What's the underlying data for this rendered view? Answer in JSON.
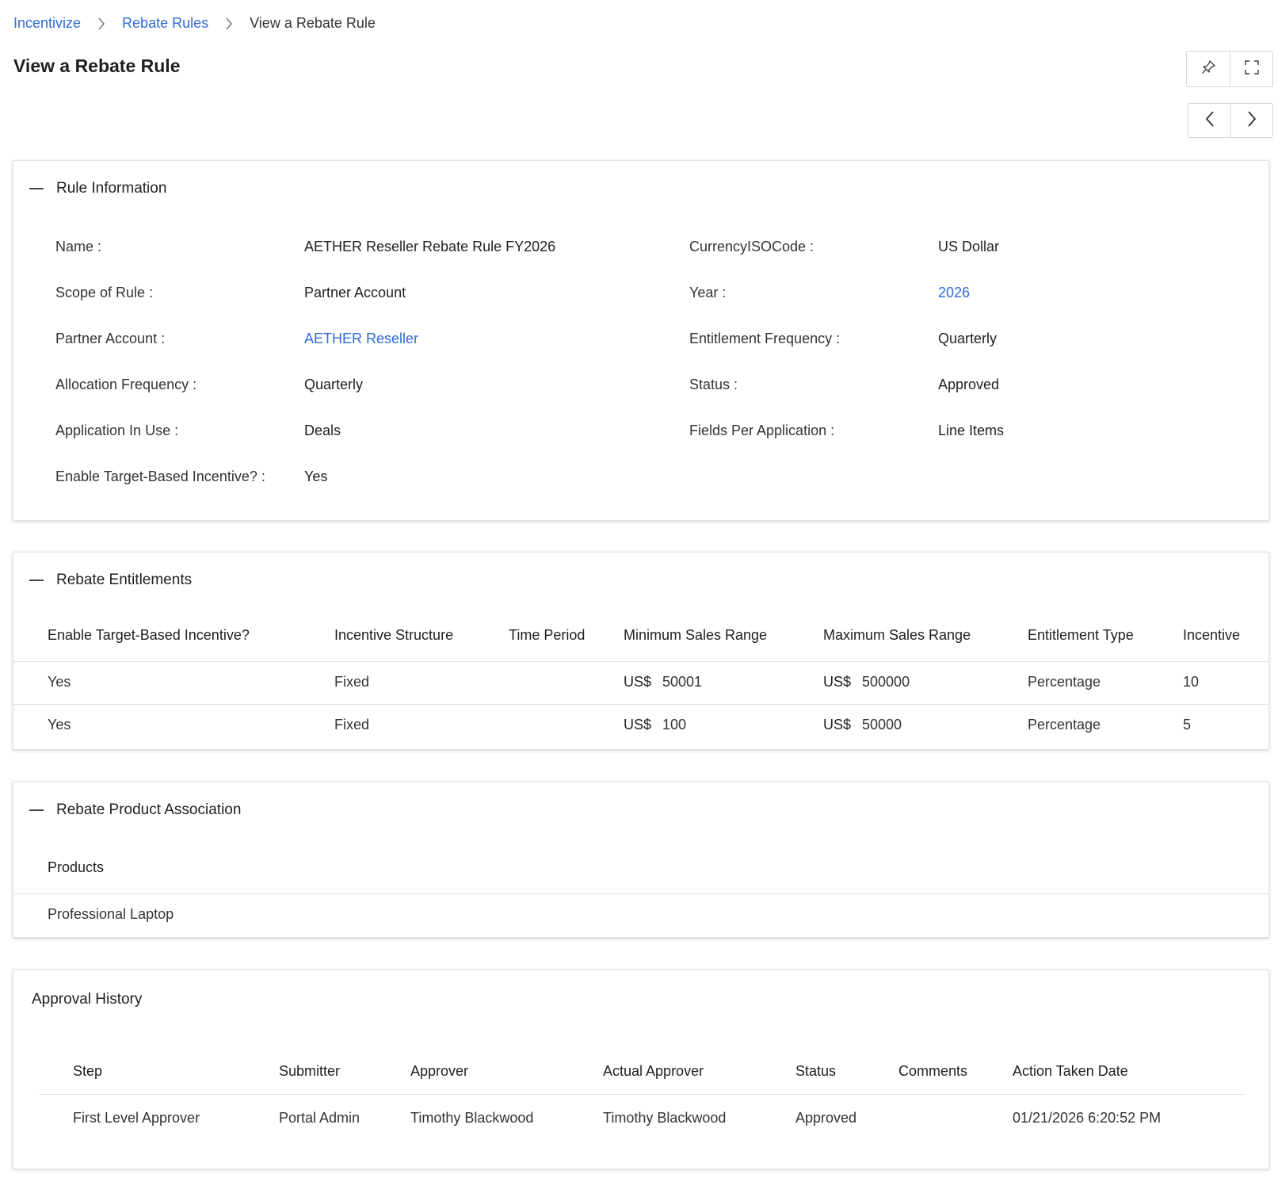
{
  "breadcrumb": [
    {
      "label": "Incentivize"
    },
    {
      "label": "Rebate Rules"
    },
    {
      "label": "View a Rebate Rule"
    }
  ],
  "page_title": "View a Rebate Rule",
  "toolbar": {
    "pin_icon": "pin-icon",
    "fullscreen_icon": "expand-icon",
    "prev_icon": "chevron-left-icon",
    "next_icon": "chevron-right-icon"
  },
  "rule_info": {
    "title": "Rule Information",
    "fields": [
      {
        "label": "Name :",
        "value": "AETHER Reseller Rebate Rule FY2026"
      },
      {
        "label": "CurrencyISOCode :",
        "value": "US Dollar"
      },
      {
        "label": "Scope of Rule :",
        "value": "Partner Account"
      },
      {
        "label": "Year :",
        "value": "2026"
      },
      {
        "label": "Partner Account :",
        "value": "AETHER Reseller"
      },
      {
        "label": "Entitlement Frequency :",
        "value": "Quarterly"
      },
      {
        "label": "Allocation Frequency :",
        "value": "Quarterly"
      },
      {
        "label": "Status :",
        "value": "Approved"
      },
      {
        "label": "Application In Use :",
        "value": "Deals"
      },
      {
        "label": "Fields Per Application :",
        "value": "Line Items"
      },
      {
        "label": "Enable Target-Based Incentive? :",
        "value": "Yes"
      }
    ]
  },
  "entitlements": {
    "title": "Rebate Entitlements",
    "headers": [
      "Enable Target-Based Incentive?",
      "Incentive Structure",
      "Time Period",
      "Minimum Sales Range",
      "Maximum Sales Range",
      "Entitlement Type",
      "Incentive"
    ],
    "rows": [
      {
        "target": "Yes",
        "structure": "Fixed",
        "period": "",
        "min_cur": "US$",
        "min": "50001",
        "max_cur": "US$",
        "max": "500000",
        "type": "Percentage",
        "incentive": "10"
      },
      {
        "target": "Yes",
        "structure": "Fixed",
        "period": "",
        "min_cur": "US$",
        "min": "100",
        "max_cur": "US$",
        "max": "50000",
        "type": "Percentage",
        "incentive": "5"
      }
    ]
  },
  "products": {
    "title": "Rebate Product Association",
    "header": "Products",
    "items": [
      "Professional Laptop"
    ]
  },
  "approval": {
    "title": "Approval History",
    "headers": [
      "Step",
      "Submitter",
      "Approver",
      "Actual Approver",
      "Status",
      "Comments",
      "Action Taken Date"
    ],
    "rows": [
      {
        "step": "First Level Approver",
        "submitter": "Portal Admin",
        "approver": "Timothy Blackwood",
        "actual": "Timothy Blackwood",
        "status": "Approved",
        "comments": "",
        "date": "01/21/2026 6:20:52 PM"
      }
    ]
  },
  "colors": {
    "link": "#2f6bd8",
    "text": "#1f1f1f",
    "border": "#e2e2e2"
  }
}
